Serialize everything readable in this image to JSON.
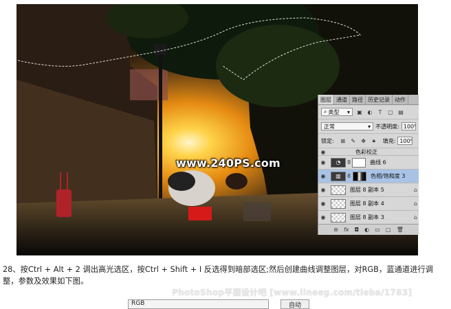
{
  "image": {
    "watermark": "www.240PS.com"
  },
  "layers_panel": {
    "tabs": [
      "图层",
      "通道",
      "路径",
      "历史记录",
      "动作"
    ],
    "filter": {
      "kind": "类型",
      "icons": [
        "image-filter-icon",
        "adjust-filter-icon",
        "type-filter-icon",
        "shape-filter-icon",
        "smart-filter-icon"
      ]
    },
    "blend_mode": "正常",
    "opacity": {
      "label": "不透明度:",
      "value": "100%"
    },
    "lock": {
      "label": "锁定:"
    },
    "fill": {
      "label": "填充:",
      "value": "100%"
    },
    "layers": [
      {
        "name": "色彩校正",
        "type": "adjustment",
        "visible": true,
        "selected": false,
        "partial": true
      },
      {
        "name": "曲线 6",
        "type": "curves",
        "visible": true,
        "selected": false
      },
      {
        "name": "色相/饱和度 3",
        "type": "huesat",
        "visible": true,
        "selected": true
      },
      {
        "name": "图层 8 副本 5",
        "type": "pixel",
        "visible": true,
        "selected": false
      },
      {
        "name": "图层 8 副本 4",
        "type": "pixel",
        "visible": true,
        "selected": false
      },
      {
        "name": "图层 8 副本 3",
        "type": "pixel",
        "visible": true,
        "selected": false
      }
    ],
    "footer_icons": [
      "link-icon",
      "fx-icon",
      "mask-icon",
      "adjustment-icon",
      "folder-icon",
      "new-layer-icon",
      "trash-icon"
    ]
  },
  "caption": "28、按Ctrl + Alt + 2 调出高光选区，按Ctrl + Shift + I 反选得到暗部选区;然后创建曲线调整图层，对RGB，蓝通道进行调整，参数及效果如下图。",
  "forum_watermark": "PhotoShop平面设计吧 [www.lineeg.com/tieba/1783]",
  "bottom_ui": {
    "channel_select": "RGB",
    "auto_button": "自动"
  }
}
